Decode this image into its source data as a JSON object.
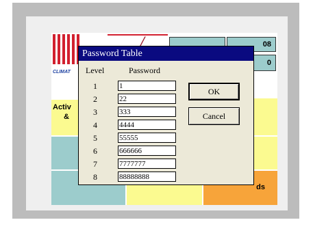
{
  "background": {
    "tiles": {
      "active_text_1": "Activ",
      "active_text_2": "&",
      "right_header_1": "08",
      "right_header_2": "0",
      "partial_glyph": "p",
      "orange_text": "ds",
      "logo_text": "CLIMAT"
    },
    "colors": {
      "teal": "#9ccccc",
      "yellow": "#fbfa90",
      "orange": "#f7a43a",
      "red": "#d2202f",
      "dialog_title": "#0a0a80"
    }
  },
  "dialog": {
    "title": "Password Table",
    "headers": {
      "level": "Level",
      "password": "Password"
    },
    "rows": [
      {
        "level": "1",
        "password": "1"
      },
      {
        "level": "2",
        "password": "22"
      },
      {
        "level": "3",
        "password": "333"
      },
      {
        "level": "4",
        "password": "4444"
      },
      {
        "level": "5",
        "password": "55555"
      },
      {
        "level": "6",
        "password": "666666"
      },
      {
        "level": "7",
        "password": "7777777"
      },
      {
        "level": "8",
        "password": "88888888"
      }
    ],
    "buttons": {
      "ok": "OK",
      "cancel": "Cancel"
    }
  }
}
